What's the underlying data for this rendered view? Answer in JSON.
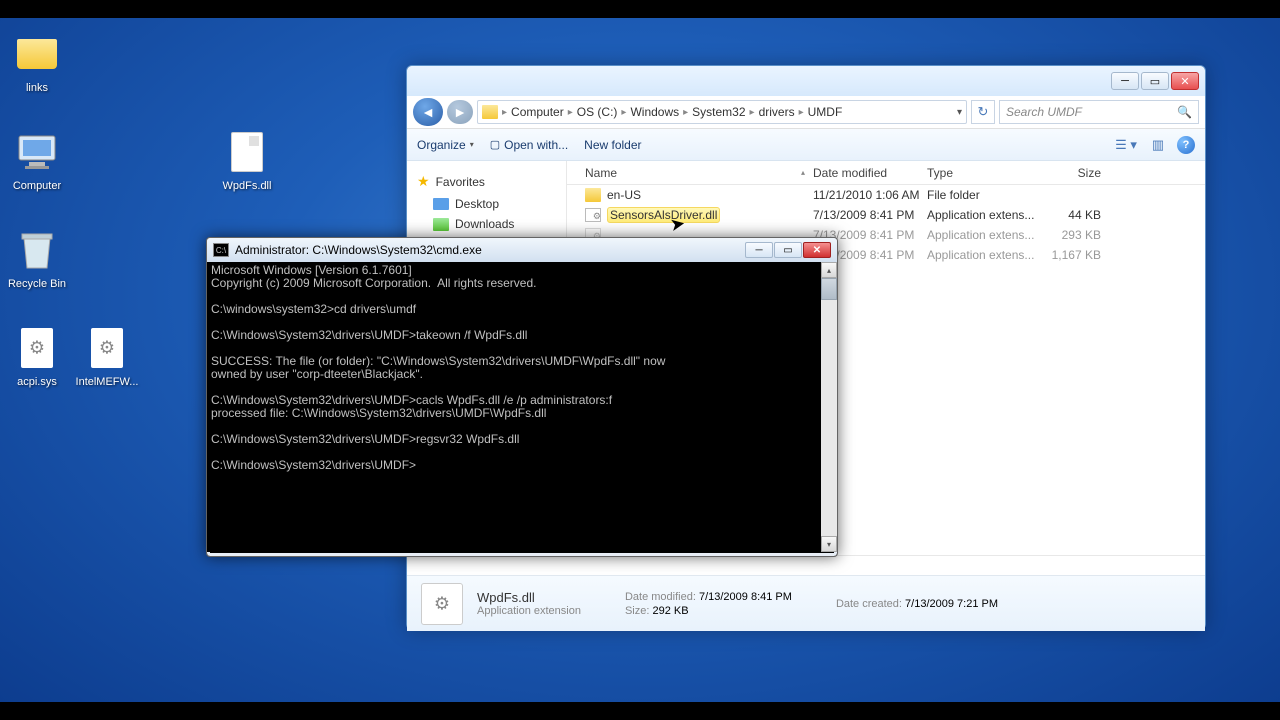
{
  "desktop_icons": {
    "links": "links",
    "computer": "Computer",
    "recycle": "Recycle Bin",
    "wpdfs": "WpdFs.dll",
    "acpi": "acpi.sys",
    "intel": "IntelMEFW..."
  },
  "explorer": {
    "breadcrumb": [
      "Computer",
      "OS (C:)",
      "Windows",
      "System32",
      "drivers",
      "UMDF"
    ],
    "search_placeholder": "Search UMDF",
    "toolbar": {
      "organize": "Organize",
      "openwith": "Open with...",
      "newfolder": "New folder"
    },
    "nav": {
      "favorites": "Favorites",
      "desktop": "Desktop",
      "downloads": "Downloads"
    },
    "columns": {
      "name": "Name",
      "date": "Date modified",
      "type": "Type",
      "size": "Size"
    },
    "rows": [
      {
        "name": "en-US",
        "date": "11/21/2010 1:06 AM",
        "type": "File folder",
        "size": "",
        "icon": "folder"
      },
      {
        "name": "SensorsAlsDriver.dll",
        "date": "7/13/2009 8:41 PM",
        "type": "Application extens...",
        "size": "44 KB",
        "icon": "dll",
        "hl": true
      },
      {
        "name": "",
        "date": "7/13/2009 8:41 PM",
        "type": "Application extens...",
        "size": "293 KB",
        "icon": "dll",
        "obscured": true
      },
      {
        "name": "",
        "date": "7/13/2009 8:41 PM",
        "type": "Application extens...",
        "size": "1,167 KB",
        "icon": "dll",
        "obscured": true
      }
    ],
    "details": {
      "name": "WpdFs.dll",
      "type": "Application extension",
      "modified_label": "Date modified:",
      "modified": "7/13/2009 8:41 PM",
      "size_label": "Size:",
      "size": "292 KB",
      "created_label": "Date created:",
      "created": "7/13/2009 7:21 PM"
    }
  },
  "cmd": {
    "title": "Administrator: C:\\Windows\\System32\\cmd.exe",
    "lines": "Microsoft Windows [Version 6.1.7601]\nCopyright (c) 2009 Microsoft Corporation.  All rights reserved.\n\nC:\\windows\\system32>cd drivers\\umdf\n\nC:\\Windows\\System32\\drivers\\UMDF>takeown /f WpdFs.dll\n\nSUCCESS: The file (or folder): \"C:\\Windows\\System32\\drivers\\UMDF\\WpdFs.dll\" now\nowned by user \"corp-dteeter\\Blackjack\".\n\nC:\\Windows\\System32\\drivers\\UMDF>cacls WpdFs.dll /e /p administrators:f\nprocessed file: C:\\Windows\\System32\\drivers\\UMDF\\WpdFs.dll\n\nC:\\Windows\\System32\\drivers\\UMDF>regsvr32 WpdFs.dll\n\nC:\\Windows\\System32\\drivers\\UMDF>"
  }
}
